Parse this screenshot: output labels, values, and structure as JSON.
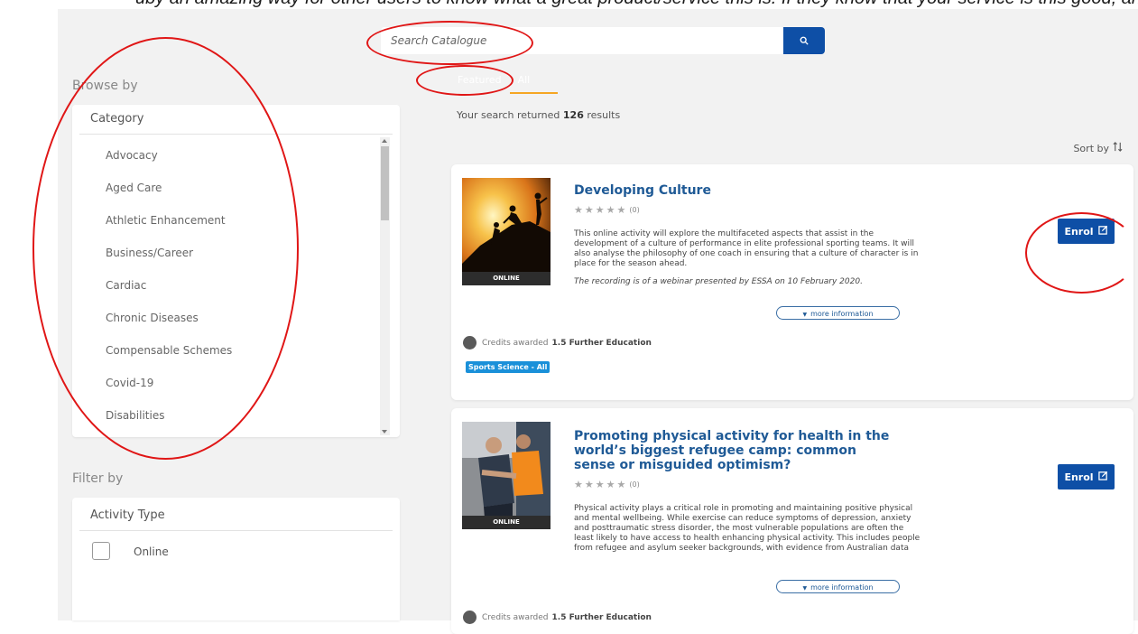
{
  "top_caption": "uby an amazing way for other users to know what a great product/service this is. If they know that your service is this good, and",
  "search": {
    "placeholder": "Search Catalogue",
    "icon": "search-icon"
  },
  "tabs": [
    {
      "label": "Featured"
    },
    {
      "label": "All"
    }
  ],
  "browse": {
    "title": "Browse by",
    "panel_header": "Category",
    "categories": [
      "Advocacy",
      "Aged Care",
      "Athletic Enhancement",
      "Business/Career",
      "Cardiac",
      "Chronic Diseases",
      "Compensable Schemes",
      "Covid-19",
      "Disabilities"
    ]
  },
  "filter": {
    "title": "Filter by",
    "panel_header": "Activity Type",
    "options": [
      {
        "label": "Online",
        "checked": false
      }
    ]
  },
  "results": {
    "prefix": "Your search returned",
    "count": "126",
    "suffix": "results",
    "sort_label": "Sort by"
  },
  "cards": [
    {
      "title": "Developing Culture",
      "rating": 0,
      "rating_count": "(0)",
      "thumb_label": "ONLINE",
      "description": "This online activity will explore the multifaceted aspects that assist in the development of a culture of performance in elite professional sporting teams. It will also analyse the philosophy of one coach in ensuring that a culture of character is in place for the season ahead.",
      "description_note": "The recording is of a webinar presented by ESSA on 10 February 2020.",
      "more_info_label": "more information",
      "credits_label": "Credits awarded",
      "credits_value": "1.5 Further Education",
      "tag": "Sports Science - All",
      "enrol_label": "Enrol"
    },
    {
      "title": "Promoting physical activity for health in the world’s biggest refugee camp: common sense or misguided optimism?",
      "rating": 0,
      "rating_count": "(0)",
      "thumb_label": "ONLINE",
      "description": "Physical activity plays a critical role in promoting and maintaining positive physical and mental wellbeing. While exercise can reduce symptoms of depression, anxiety and posttraumatic stress disorder, the most vulnerable populations are often the least likely to have access to health enhancing physical activity. This includes people from refugee and asylum seeker backgrounds, with evidence from Australian data",
      "more_info_label": "more information",
      "credits_label": "Credits awarded",
      "credits_value": "1.5 Further Education",
      "enrol_label": "Enrol"
    }
  ],
  "colors": {
    "primary_button": "#0e4fa6",
    "title_link": "#1f5a96",
    "tab_underline": "#f5a623",
    "tag_bg": "#1a90d9",
    "annotation_red": "#e01616",
    "page_bg": "#f2f2f2"
  }
}
